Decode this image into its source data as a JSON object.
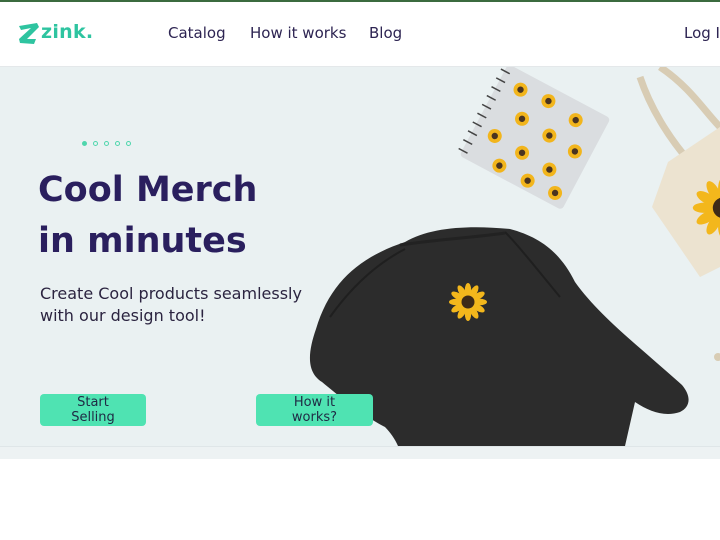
{
  "nav": {
    "logo_text": "zink.",
    "links": [
      "Catalog",
      "How it works",
      "Blog"
    ],
    "login": "Log In"
  },
  "hero": {
    "headline_line1": "Cool Merch",
    "headline_line2": "in minutes",
    "subtitle_line1": "Create Cool products seamlessly",
    "subtitle_line2": "with our design tool!",
    "primary_cta": "Start Selling",
    "secondary_cta": "How it works?",
    "slides_total": 5,
    "active_slide": 1,
    "products": [
      "notebook",
      "sweatshirt",
      "tote-bag"
    ]
  },
  "colors": {
    "brand": "#2ec4a0",
    "button": "#4fe3b2",
    "hero_bg": "#eaf1f2",
    "headline": "#2a1f5e"
  }
}
